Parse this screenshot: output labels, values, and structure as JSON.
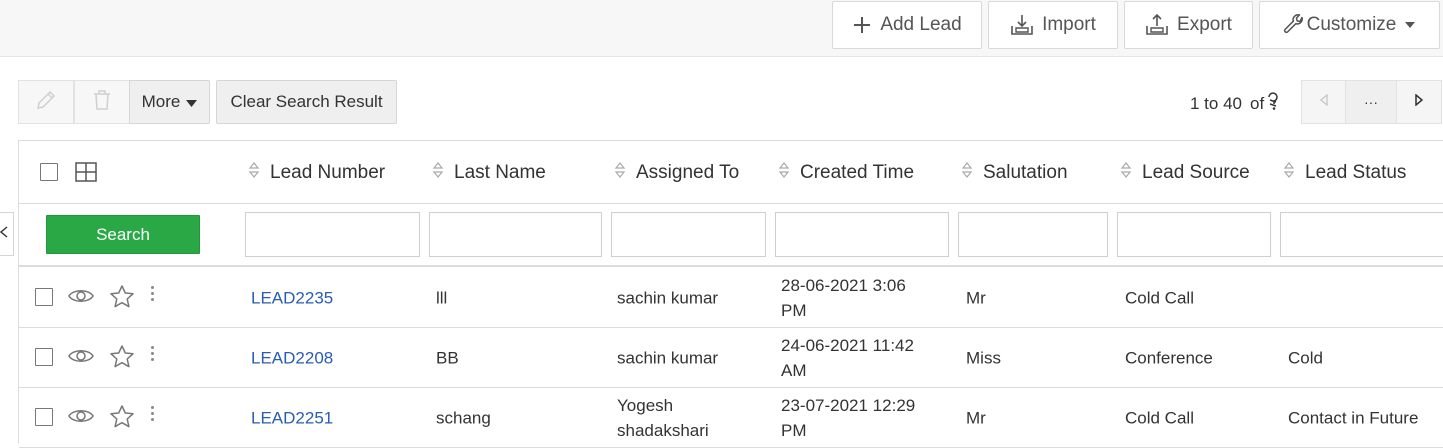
{
  "topbar": {
    "add_lead": "Add Lead",
    "import": "Import",
    "export": "Export",
    "customize": "Customize"
  },
  "toolbar": {
    "more": "More",
    "clear_search": "Clear Search Result",
    "pager_range": "1 to 40",
    "pager_of": "of",
    "pager_ellipsis": "···"
  },
  "table": {
    "columns": [
      "Lead Number",
      "Last Name",
      "Assigned To",
      "Created Time",
      "Salutation",
      "Lead Source",
      "Lead Status"
    ],
    "search_label": "Search",
    "rows": [
      {
        "lead_number": "LEAD2235",
        "last_name": "lll",
        "assigned_to": "sachin kumar",
        "created_line1": "28-06-2021 3:06",
        "created_line2": "PM",
        "salutation": "Mr",
        "lead_source": "Cold Call",
        "lead_status": ""
      },
      {
        "lead_number": "LEAD2208",
        "last_name": "BB",
        "assigned_to": "sachin kumar",
        "created_line1": "24-06-2021 11:42",
        "created_line2": "AM",
        "salutation": "Miss",
        "lead_source": "Conference",
        "lead_status": "Cold"
      },
      {
        "lead_number": "LEAD2251",
        "last_name": "schang",
        "assigned_to_line1": "Yogesh",
        "assigned_to_line2": "shadakshari",
        "created_line1": "23-07-2021 12:29",
        "created_line2": "PM",
        "salutation": "Mr",
        "lead_source": "Cold Call",
        "lead_status": "Contact in Future"
      }
    ]
  },
  "colors": {
    "search_button": "#2aa845",
    "link": "#2a5cb3"
  }
}
